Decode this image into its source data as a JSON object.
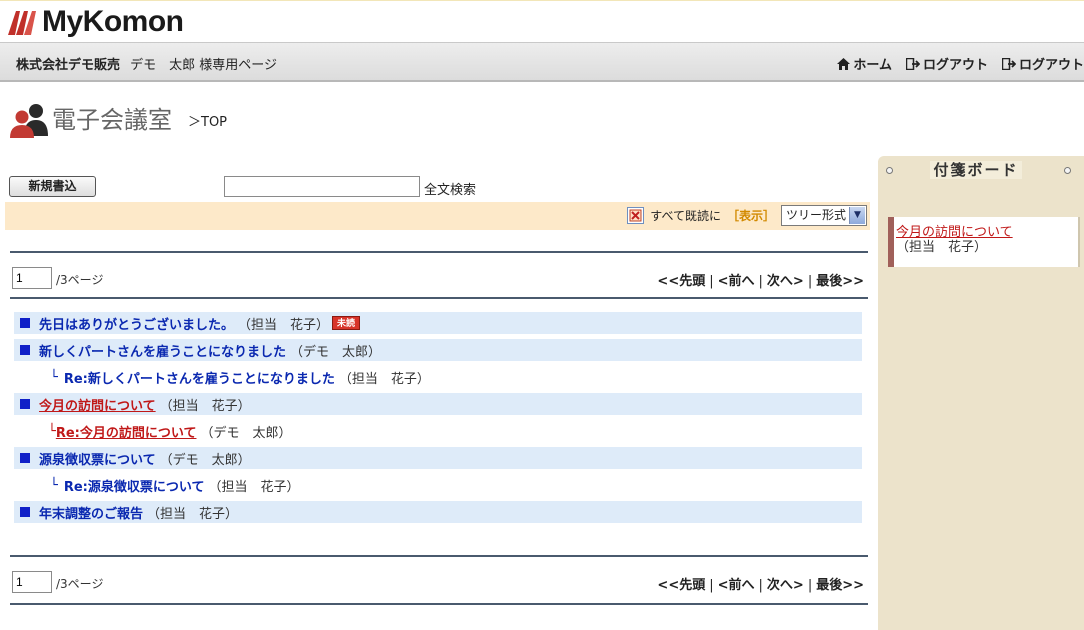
{
  "brand": {
    "name": "MyKomon"
  },
  "user_bar": {
    "company": "株式会社デモ販売",
    "user": "デモ　太郎 様専用ページ",
    "home": "ホーム",
    "logout1": "ログアウト",
    "logout2": "ログアウト"
  },
  "page": {
    "title": "電子会議室",
    "breadcrumb": "＞TOP"
  },
  "toolbar": {
    "new_post": "新規書込",
    "search_value": "",
    "search_label": "全文検索"
  },
  "filter": {
    "mark_read": "すべて既読に",
    "display": "［表示］",
    "view_mode": "ツリー形式"
  },
  "pager": {
    "current": "1",
    "total": "/3ページ",
    "first": "<<先頭",
    "prev": "<前へ",
    "next": "次へ>",
    "last": "最後>>",
    "sep": "|"
  },
  "threads": [
    {
      "title": "先日はありがとうございました。",
      "author": "（担当　花子）",
      "badge": "未読"
    },
    {
      "title": "新しくパートさんを雇うことになりました",
      "author": "（デモ　太郎）"
    },
    {
      "reply_mark": "└",
      "title": "Re:新しくパートさんを雇うことになりました",
      "author": "（担当　花子）"
    },
    {
      "title": "今月の訪問について",
      "author": "（担当　花子）"
    },
    {
      "reply_mark": "└",
      "title": "Re:今月の訪問について",
      "author": "（デモ　太郎）"
    },
    {
      "title": "源泉徴収票について",
      "author": "（デモ　太郎）"
    },
    {
      "reply_mark": "└",
      "title": "Re:源泉徴収票について",
      "author": "（担当　花子）"
    },
    {
      "title": "年末調整のご報告",
      "author": "（担当　花子）"
    }
  ],
  "board": {
    "title": "付箋ボード",
    "items": [
      {
        "title": "今月の訪問について",
        "author": "（担当　花子）"
      }
    ]
  },
  "colors": {
    "link": "#0a28b0",
    "visited": "#c01818",
    "row_bg": "#deebf9",
    "filter_bg": "#fde9c9",
    "board_bg": "#ece3cb"
  }
}
